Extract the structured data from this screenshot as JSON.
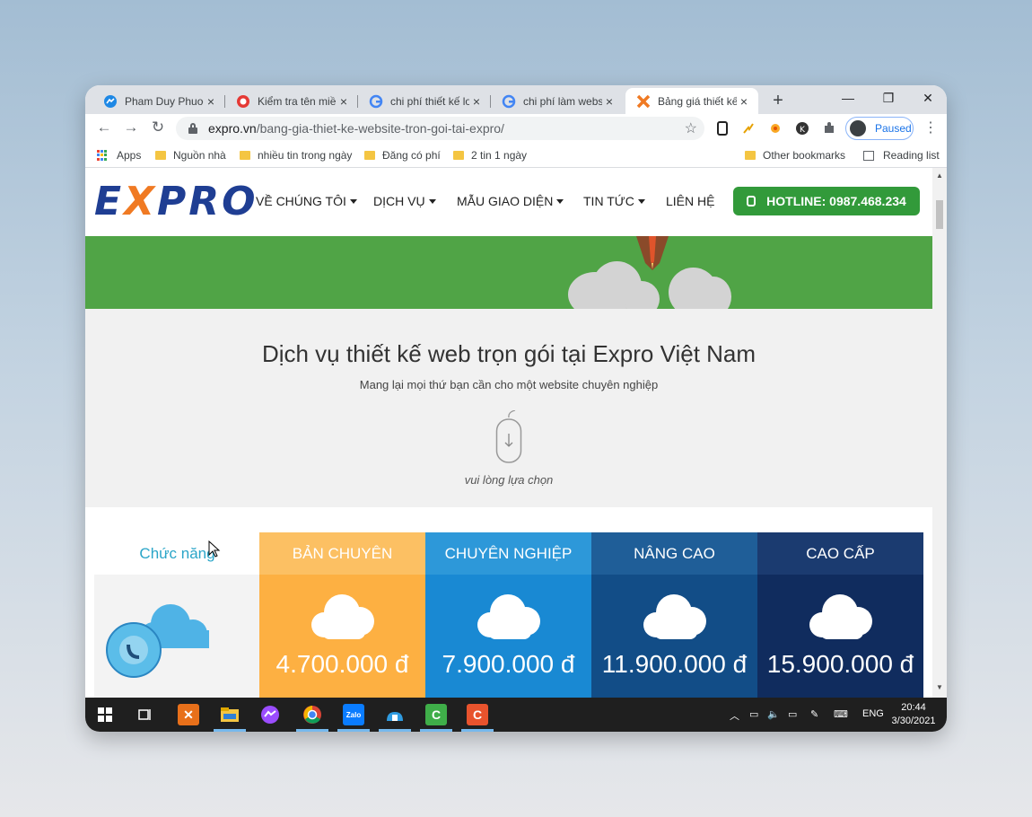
{
  "browser": {
    "tabs": [
      {
        "title": "Pham Duy Phuoc",
        "icon": "messenger-icon",
        "active": false
      },
      {
        "title": "Kiểm tra tên miền",
        "icon": "site-icon",
        "active": false
      },
      {
        "title": "chi phí thiết kế lo",
        "icon": "google-icon",
        "active": false
      },
      {
        "title": "chi phí làm websi",
        "icon": "google-icon",
        "active": false
      },
      {
        "title": "Bảng giá thiết kế",
        "icon": "expro-icon",
        "active": true
      }
    ],
    "new_tab": "+",
    "close_glyph": "×",
    "window_controls": {
      "minimize": "—",
      "maximize": "❐",
      "close": "✕"
    },
    "url_host": "expro.vn",
    "url_path": "/bang-gia-thiet-ke-website-tron-goi-tai-expro/",
    "profile_label": "Paused",
    "bookmarks": [
      {
        "label": "Apps",
        "type": "apps"
      },
      {
        "label": "Nguồn nhà",
        "type": "folder"
      },
      {
        "label": "nhiều tin trong ngày",
        "type": "folder"
      },
      {
        "label": "Đăng có phí",
        "type": "folder"
      },
      {
        "label": "2 tin 1 ngày",
        "type": "folder"
      },
      {
        "label": "Other bookmarks",
        "type": "folder"
      },
      {
        "label": "Reading list",
        "type": "reading"
      }
    ]
  },
  "site": {
    "logo_left": "E",
    "logo_x": "X",
    "logo_right": "PRO",
    "menu": [
      {
        "label": "VỀ CHÚNG TÔI",
        "dropdown": true
      },
      {
        "label": "DỊCH VỤ",
        "dropdown": true
      },
      {
        "label": "MẪU GIAO DIỆN",
        "dropdown": true
      },
      {
        "label": "TIN TỨC",
        "dropdown": true
      },
      {
        "label": "LIÊN HỆ",
        "dropdown": false
      }
    ],
    "hotline": "HOTLINE: 0987.468.234",
    "section_title": "Dịch vụ thiết kế web trọn gói tại Expro Việt Nam",
    "section_subtitle": "Mang lại mọi thứ bạn cần cho một website chuyên nghiệp",
    "scroll_caption": "vui lòng lựa chọn",
    "feature_label": "Chức năng",
    "plans": [
      {
        "name": "BẢN CHUYÊN",
        "price": "4.700.000 đ",
        "head_color": "#fcc063",
        "body_color": "#fdb042"
      },
      {
        "name": "CHUYÊN NGHIỆP",
        "price": "7.900.000 đ",
        "head_color": "#2d98d9",
        "body_color": "#1989d3"
      },
      {
        "name": "NÂNG CAO",
        "price": "11.900.000 đ",
        "head_color": "#1f5e98",
        "body_color": "#124d87"
      },
      {
        "name": "CAO CẤP",
        "price": "15.900.000 đ",
        "head_color": "#1b3b70",
        "body_color": "#102c5e"
      }
    ]
  },
  "taskbar": {
    "apps": [
      "windows-start",
      "task-view",
      "xampp",
      "file-explorer",
      "messenger",
      "chrome",
      "zalo",
      "network-app",
      "camtasia-green",
      "camtasia-orange"
    ],
    "lang": "ENG",
    "time": "20:44",
    "date": "3/30/2021"
  }
}
